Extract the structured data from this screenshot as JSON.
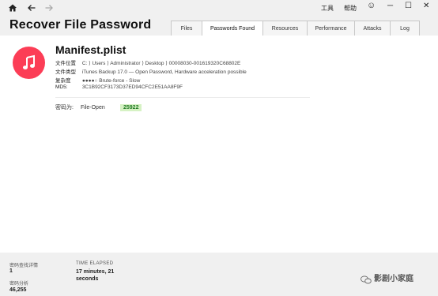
{
  "toolbar": {
    "home_icon": "home-icon",
    "back_icon": "arrow-left-icon",
    "forward_icon": "arrow-right-icon"
  },
  "menu": {
    "tools": "工具",
    "help": "帮助"
  },
  "window_controls": {
    "smiley": "☺",
    "minimize": "─",
    "maximize": "☐",
    "close": "✕"
  },
  "app_title": "Recover File Password",
  "tabs": [
    {
      "label": "Files",
      "active": false
    },
    {
      "label": "Passwords Found",
      "active": true
    },
    {
      "label": "Resources",
      "active": false
    },
    {
      "label": "Performance",
      "active": false
    },
    {
      "label": "Attacks",
      "active": false
    },
    {
      "label": "Log",
      "active": false
    }
  ],
  "file": {
    "name": "Manifest.plist",
    "icon": "music-note-icon",
    "icon_color": "#fc3d56",
    "details": [
      {
        "key": "文件位置",
        "value": "C: ⟩ Users ⟩ Administrator ⟩ Desktop ⟩ 00008030-001619320C68802E"
      },
      {
        "key": "文件类型",
        "value": "iTunes Backup 17.0 — Open Password, Hardware acceleration possible"
      },
      {
        "key": "复杂度",
        "value": "●●●●○ Brute-force - Slow"
      },
      {
        "key": "MD5:",
        "value": "3C1B92CF3173D37ED94CFC2E51AA8F9F"
      }
    ]
  },
  "password": {
    "label": "密码为:",
    "attack": "File-Open",
    "value": "25922",
    "value_color": "#d6f2c4"
  },
  "stats": {
    "left_label_1": "密码查找详情",
    "left_value_1": "1",
    "left_label_2": "密码分析",
    "left_value_2": "46,255",
    "elapsed_label": "TIME ELAPSED",
    "elapsed_value": "17 minutes, 21 seconds"
  },
  "watermark": {
    "text": "影剧小家庭"
  }
}
